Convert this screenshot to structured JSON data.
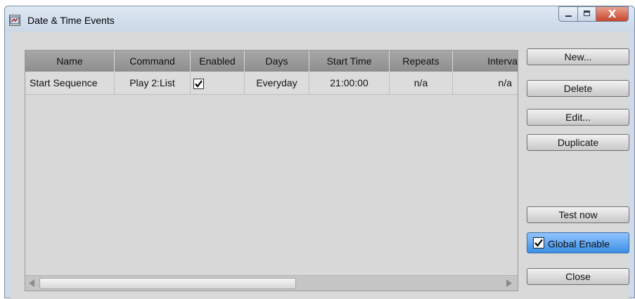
{
  "window": {
    "title": "Date & Time Events",
    "controls": {
      "minimize": "minimize",
      "maximize": "maximize",
      "close": "X"
    }
  },
  "table": {
    "columns": [
      {
        "label": "Name"
      },
      {
        "label": "Command"
      },
      {
        "label": "Enabled"
      },
      {
        "label": "Days"
      },
      {
        "label": "Start Time"
      },
      {
        "label": "Repeats"
      },
      {
        "label": "Interva"
      }
    ],
    "rows": [
      {
        "name": "Start Sequence",
        "command": "Play 2:List",
        "enabled": true,
        "days": "Everyday",
        "start_time": "21:00:00",
        "repeats": "n/a",
        "interval": "n/a"
      }
    ]
  },
  "buttons": {
    "new": "New...",
    "delete": "Delete",
    "edit": "Edit...",
    "duplicate": "Duplicate",
    "test_now": "Test now",
    "global_enable": "Global Enable",
    "close": "Close"
  },
  "global_enable_checked": true,
  "colors": {
    "highlight": "#3b8fe6",
    "header": "#9e9e9e"
  },
  "icons": {
    "app": "clock-window-icon",
    "check": "checkmark-icon"
  }
}
